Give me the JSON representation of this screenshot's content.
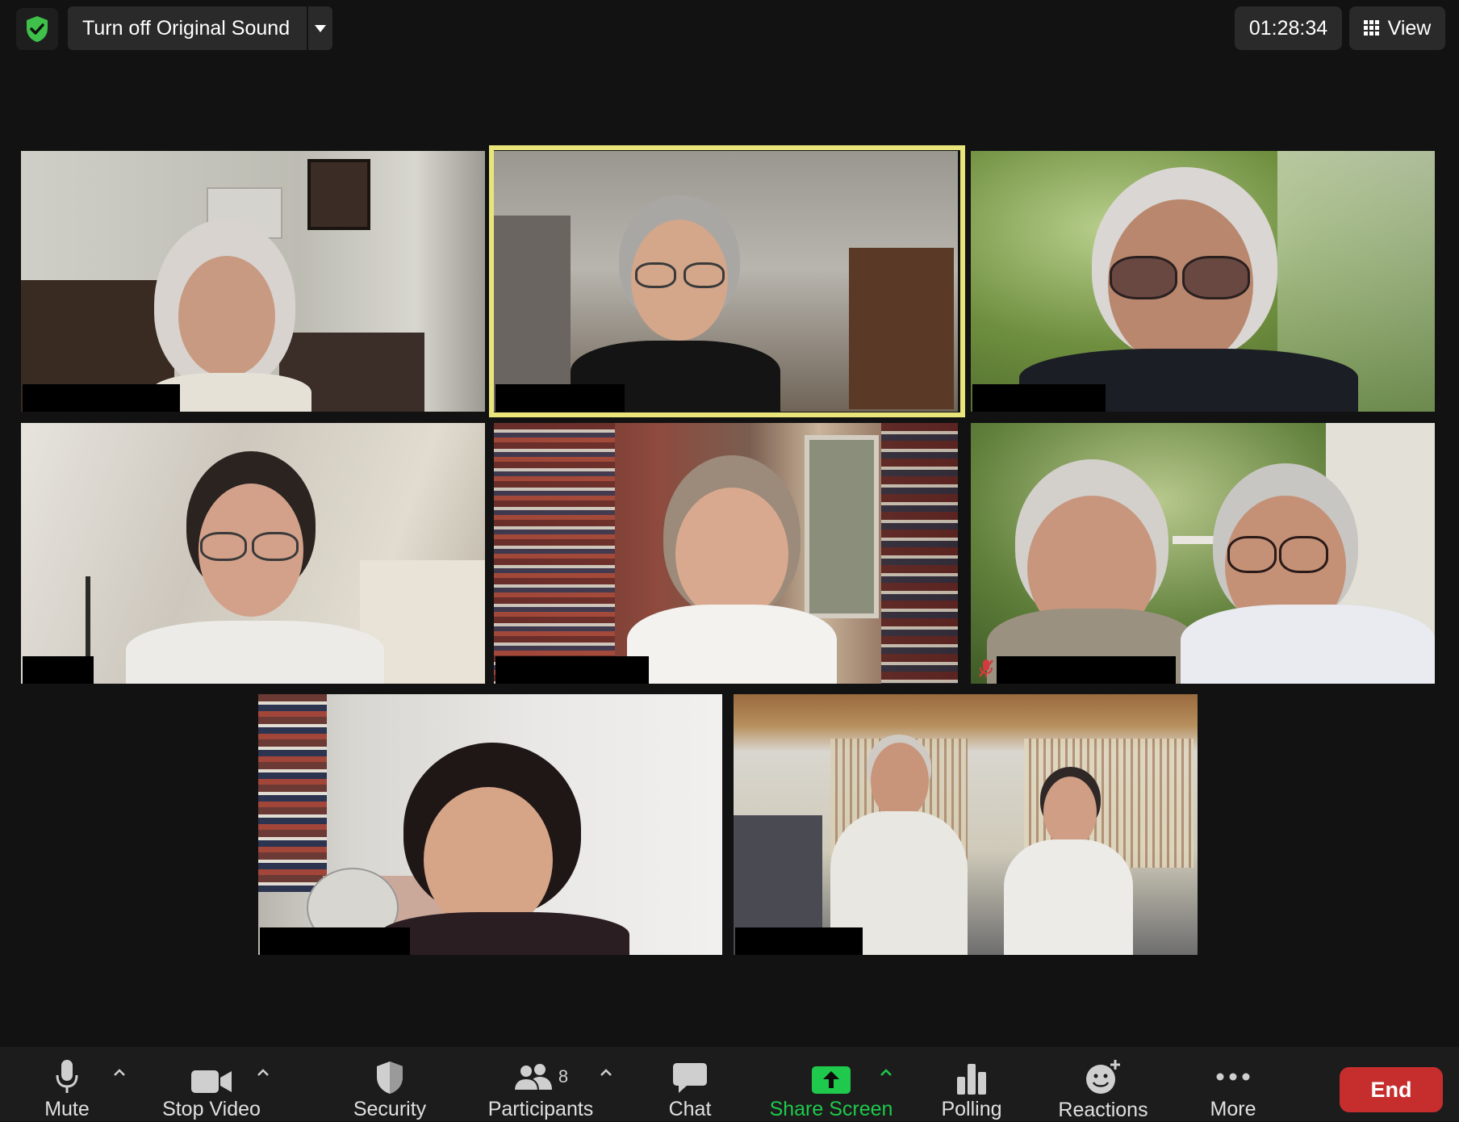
{
  "topbar": {
    "original_sound_label": "Turn off Original Sound",
    "timer": "01:28:34",
    "view_label": "View"
  },
  "colors": {
    "security_shield": "#3ec04a",
    "active_speaker_border": "#e9e57a",
    "share_screen": "#1ec94c",
    "end_button": "#c62d2d"
  },
  "participants_count": "8",
  "toolbar": {
    "mute_label": "Mute",
    "stop_video_label": "Stop Video",
    "security_label": "Security",
    "participants_label": "Participants",
    "chat_label": "Chat",
    "share_screen_label": "Share Screen",
    "polling_label": "Polling",
    "reactions_label": "Reactions",
    "more_label": "More",
    "end_label": "End"
  },
  "icons": [
    "security-shield-icon",
    "chevron-down-icon",
    "grid-view-icon",
    "microphone-icon",
    "video-camera-icon",
    "shield-icon",
    "participants-icon",
    "chat-bubble-icon",
    "share-screen-arrow-icon",
    "polling-bars-icon",
    "reactions-smiley-icon",
    "more-dots-icon",
    "muted-microphone-icon"
  ]
}
